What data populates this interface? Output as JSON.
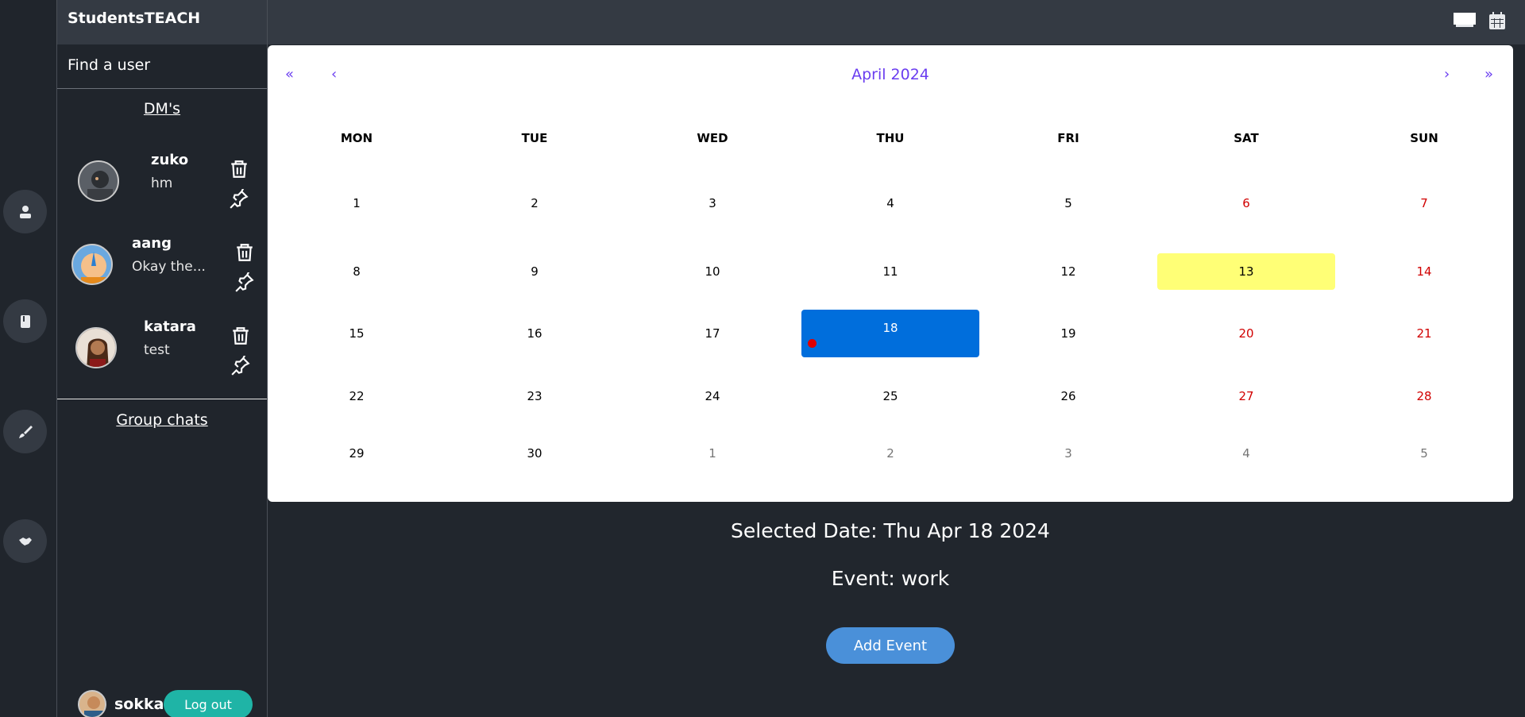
{
  "app": {
    "title": "StudentsTEACH"
  },
  "sidebar": {
    "find_user": "Find a user",
    "dms_title": "DM's",
    "dms": [
      {
        "name": "zuko",
        "message": "hm"
      },
      {
        "name": "aang",
        "message": "Okay the..."
      },
      {
        "name": "katara",
        "message": "test"
      }
    ],
    "group_chats_title": "Group chats",
    "current_user": "sokka",
    "logout_label": "Log out"
  },
  "rail": {
    "icons": [
      "user-icon",
      "book-icon",
      "brush-icon",
      "handshake-icon"
    ]
  },
  "topbar": {
    "icons": [
      "whiteboard-icon",
      "calendar-icon"
    ]
  },
  "calendar": {
    "month_label": "April 2024",
    "nav": {
      "prev_year": "«",
      "prev_month": "‹",
      "next_month": "›",
      "next_year": "»"
    },
    "weekdays": [
      "MON",
      "TUE",
      "WED",
      "THU",
      "FRI",
      "SAT",
      "SUN"
    ],
    "weeks": [
      [
        "1",
        "2",
        "3",
        "4",
        "5",
        "6",
        "7"
      ],
      [
        "8",
        "9",
        "10",
        "11",
        "12",
        "13",
        "14"
      ],
      [
        "15",
        "16",
        "17",
        "18",
        "19",
        "20",
        "21"
      ],
      [
        "22",
        "23",
        "24",
        "25",
        "26",
        "27",
        "28"
      ],
      [
        "29",
        "30",
        "1",
        "2",
        "3",
        "4",
        "5"
      ]
    ],
    "today": "13",
    "selected": "18",
    "colors": {
      "accent": "#6a3df0",
      "weekend": "#d10000",
      "today_bg": "#ffff76",
      "selected_bg": "#006edc",
      "event_dot": "#e00000"
    }
  },
  "details": {
    "selected_date": "Selected Date: Thu Apr 18 2024",
    "event": "Event: work",
    "add_event_label": "Add Event"
  }
}
